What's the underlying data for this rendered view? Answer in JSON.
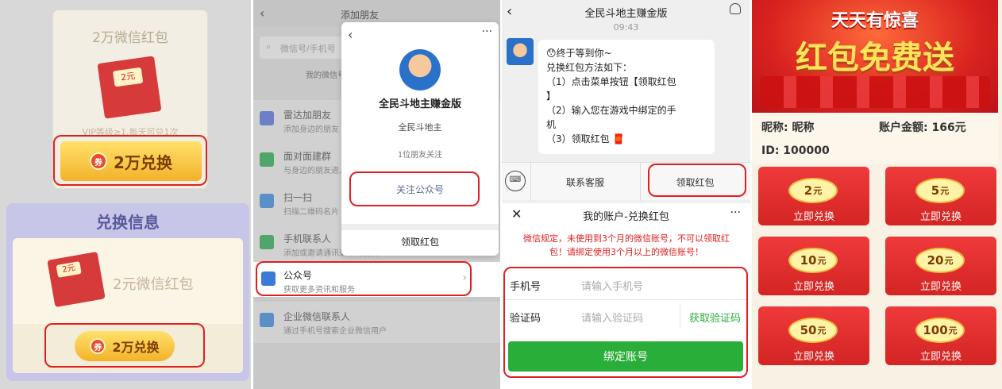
{
  "panel1": {
    "card_title": "2万微信红包",
    "env_text": "2元",
    "vip_text": "VIP等级≥1,每天可兑1次",
    "exchange_btn_top": "2万兑换",
    "section_header": "兑换信息",
    "env_text2": "2元",
    "card2_title": "2元微信红包",
    "exchange_btn_bottom": "2万兑换",
    "ticket_icon_text": "券"
  },
  "panel2": {
    "top_title": "添加朋友",
    "search_placeholder": "微信号/手机号",
    "my_id": "我的微信号",
    "rows": [
      {
        "title": "雷达加朋友",
        "sub": "添加身边的朋友"
      },
      {
        "title": "面对面建群",
        "sub": "与身边的朋友进入同一个群聊"
      },
      {
        "title": "扫一扫",
        "sub": "扫描二维码名片"
      },
      {
        "title": "手机联系人",
        "sub": "添加或邀请通讯录中的朋友"
      }
    ],
    "gzh_title": "公众号",
    "gzh_sub": "获取更多资讯和服务",
    "ent_title": "企业微信联系人",
    "ent_sub": "通过手机号搜索企业微信用户",
    "popup": {
      "name": "全民斗地主赚金版",
      "sub": "全民斗地主",
      "friends": "1位朋友关注",
      "follow_btn": "关注公众号",
      "claim": "领取红包"
    }
  },
  "panel3": {
    "title": "全民斗地主赚金版",
    "time": "09:43",
    "msg_lines": [
      "😯终于等到你~",
      "兑换红包方法如下：",
      "（1）点击菜单按钮【领取红包",
      "】",
      "（2）输入您在游戏中绑定的手",
      "机",
      "（3）领取红包 🧧"
    ],
    "menu_service": "联系客服",
    "menu_claim": "领取红包",
    "sheet_title": "我的账户-兑换红包",
    "notice": "微信规定，未使用到3个月的微信账号，不可以领取红包！请绑定使用3个月以上的微信账号！",
    "phone_label": "手机号",
    "phone_placeholder": "请输入手机号",
    "code_label": "验证码",
    "code_placeholder": "请输入验证码",
    "get_code": "获取验证码",
    "bind_btn": "绑定账号"
  },
  "panel4": {
    "banner_top": "天天有惊喜",
    "banner_main": "红包免费送",
    "nick": "昵称: 昵称",
    "balance": "账户金额: 166元",
    "id": "ID: 100000",
    "tiles": [
      {
        "amount": "2",
        "unit": "元",
        "label": "立即兑换"
      },
      {
        "amount": "5",
        "unit": "元",
        "label": "立即兑换"
      },
      {
        "amount": "10",
        "unit": "元",
        "label": "立即兑换"
      },
      {
        "amount": "20",
        "unit": "元",
        "label": "立即兑换"
      },
      {
        "amount": "50",
        "unit": "元",
        "label": "立即兑换"
      },
      {
        "amount": "100",
        "unit": "元",
        "label": "立即兑换"
      }
    ]
  },
  "colors": {
    "highlight": "#e02020",
    "wechat_green": "#2aae3a",
    "red_packet": "#d42424"
  }
}
